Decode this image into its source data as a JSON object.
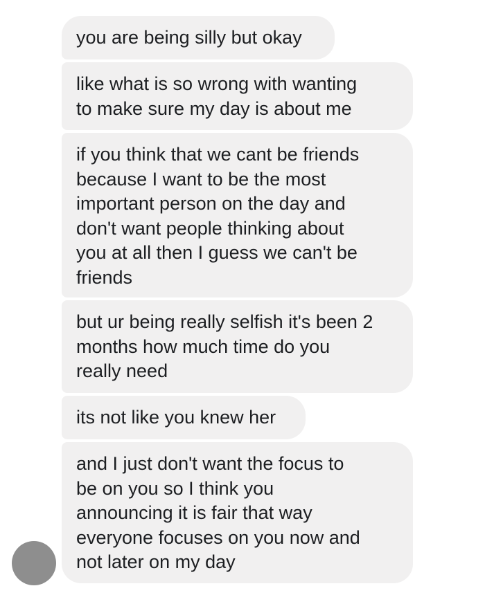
{
  "conversation": {
    "messages": [
      {
        "text": "you are being silly but okay"
      },
      {
        "text": "like what is so wrong with wanting\nto make sure my day is about me"
      },
      {
        "text": "if you think that we cant be friends\nbecause I want to be the most\nimportant person on the day and\ndon't want people thinking about\nyou at all then I guess we can't be\nfriends"
      },
      {
        "text": "but ur being really selfish it's been 2\nmonths how much time do you\nreally need"
      },
      {
        "text": "its not like you knew her"
      },
      {
        "text": "and I just don't want the focus to\nbe on you so I think you\nannouncing it is fair that way\neveryone focuses on you now and\nnot later on my day"
      }
    ]
  },
  "colors": {
    "bubble_background": "#f1f0f0",
    "text": "#1c1e21",
    "avatar": "#8e8e8e",
    "page_background": "#ffffff"
  }
}
